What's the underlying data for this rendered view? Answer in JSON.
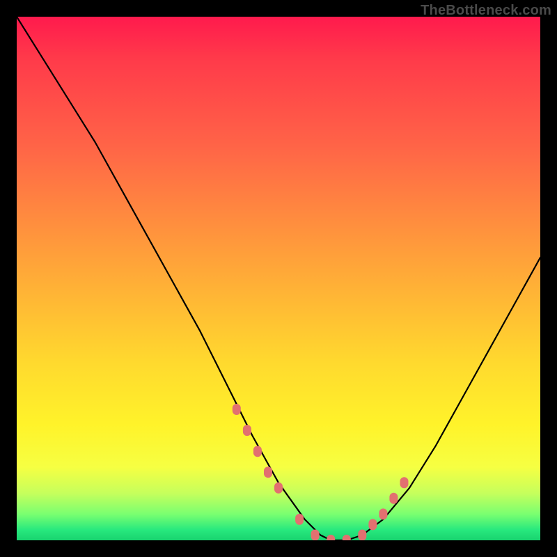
{
  "watermark": "TheBottleneck.com",
  "chart_data": {
    "type": "line",
    "title": "",
    "xlabel": "",
    "ylabel": "",
    "xlim": [
      0,
      100
    ],
    "ylim": [
      0,
      100
    ],
    "series": [
      {
        "name": "bottleneck-curve",
        "x": [
          0,
          5,
          10,
          15,
          20,
          25,
          30,
          35,
          40,
          45,
          50,
          55,
          58,
          60,
          63,
          66,
          70,
          75,
          80,
          85,
          90,
          95,
          100
        ],
        "y": [
          100,
          92,
          84,
          76,
          67,
          58,
          49,
          40,
          30,
          20,
          11,
          4,
          1,
          0,
          0,
          1,
          4,
          10,
          18,
          27,
          36,
          45,
          54
        ]
      }
    ],
    "markers": {
      "name": "highlight-dots",
      "color": "#e27070",
      "x": [
        42,
        44,
        46,
        48,
        50,
        54,
        57,
        60,
        63,
        66,
        68,
        70,
        72,
        74
      ],
      "y": [
        25,
        21,
        17,
        13,
        10,
        4,
        1,
        0,
        0,
        1,
        3,
        5,
        8,
        11
      ]
    },
    "gradient_stops": [
      {
        "pos": 0.0,
        "color": "#ff1a4d"
      },
      {
        "pos": 0.25,
        "color": "#ff6547"
      },
      {
        "pos": 0.52,
        "color": "#ffb236"
      },
      {
        "pos": 0.78,
        "color": "#fff32a"
      },
      {
        "pos": 0.95,
        "color": "#7aff70"
      },
      {
        "pos": 1.0,
        "color": "#18d36f"
      }
    ]
  }
}
